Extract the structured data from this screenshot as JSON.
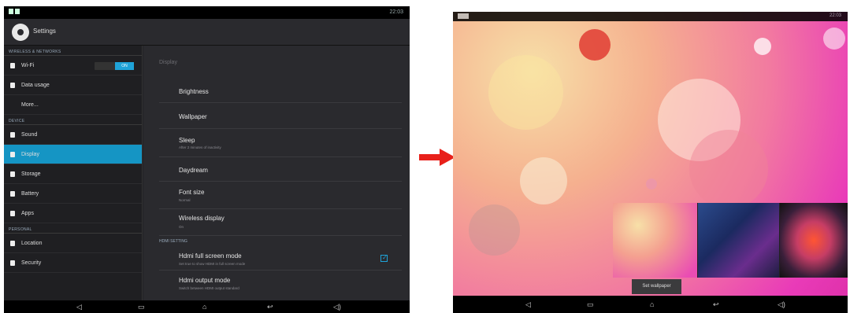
{
  "left": {
    "status_right": "22:03",
    "title": "Settings",
    "sections": {
      "wireless": "WIRELESS & NETWORKS",
      "device": "DEVICE",
      "personal": "PERSONAL"
    },
    "menu": [
      {
        "label": "Wi-Fi",
        "icon": "wifi-icon"
      },
      {
        "label": "Data usage",
        "icon": "data-usage-icon"
      },
      {
        "label": "More...",
        "icon": ""
      },
      {
        "label": "Sound",
        "icon": "sound-icon"
      },
      {
        "label": "Display",
        "icon": "display-icon"
      },
      {
        "label": "Storage",
        "icon": "storage-icon"
      },
      {
        "label": "Battery",
        "icon": "battery-icon"
      },
      {
        "label": "Apps",
        "icon": "apps-icon"
      },
      {
        "label": "Location",
        "icon": "location-icon"
      },
      {
        "label": "Security",
        "icon": "security-icon"
      }
    ],
    "wifi_toggle": "ON",
    "content_title": "Display",
    "rows": [
      {
        "title": "Brightness",
        "sub": ""
      },
      {
        "title": "Wallpaper",
        "sub": ""
      },
      {
        "title": "Sleep",
        "sub": "After 2 minutes of inactivity"
      },
      {
        "title": "Daydream",
        "sub": ""
      },
      {
        "title": "Font size",
        "sub": "Normal"
      },
      {
        "title": "Wireless display",
        "sub": "On"
      }
    ],
    "hdmi_section": "HDMI SETTING",
    "hdmi_rows": [
      {
        "title": "Hdmi full screen mode",
        "sub": "Set true to show HDMI in full screen mode"
      },
      {
        "title": "Hdmi output mode",
        "sub": "Switch between HDMI output standard"
      }
    ],
    "nav": [
      "◁",
      "▭",
      "⌂",
      "↩",
      "◁)"
    ]
  },
  "right": {
    "status_right": "22:03",
    "set_wallpaper": "Set wallpaper",
    "nav": [
      "◁",
      "▭",
      "⌂",
      "↩",
      "◁)"
    ]
  },
  "colors": {
    "accent": "#1595c4",
    "arrow": "#e8201a"
  }
}
